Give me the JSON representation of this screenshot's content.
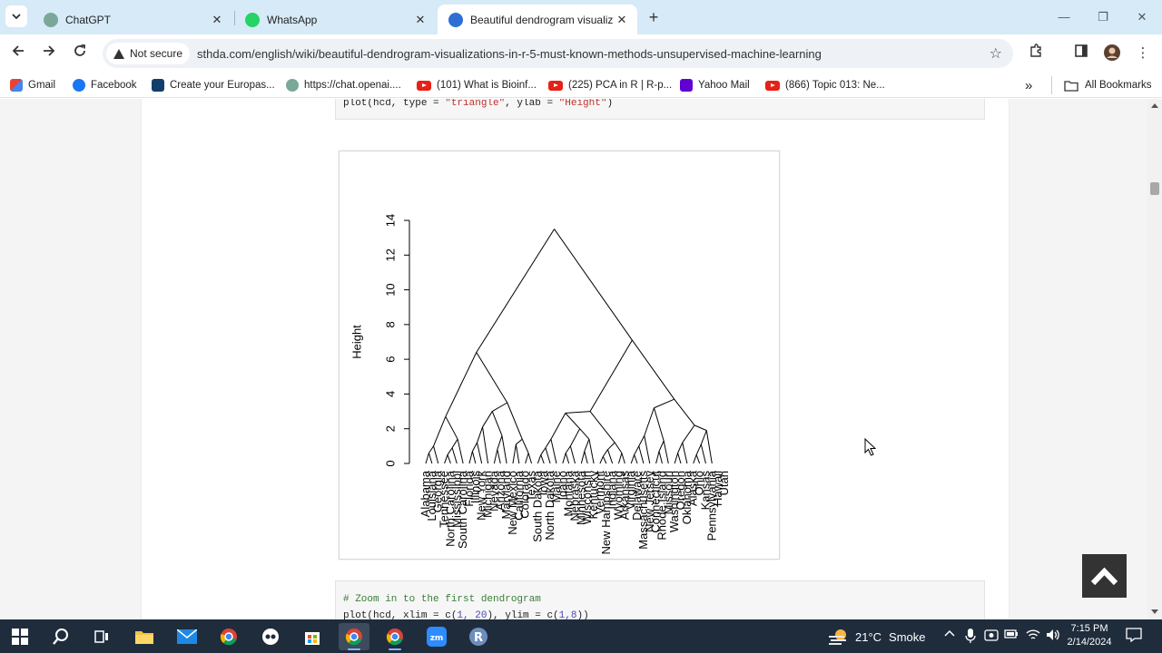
{
  "browser": {
    "tabs": [
      {
        "label": "ChatGPT",
        "color": "#7aa79a"
      },
      {
        "label": "WhatsApp",
        "color": "#25d366"
      },
      {
        "label": "Beautiful dendrogram visualiza",
        "color": "#2e6fd6"
      }
    ],
    "new_tab_icon": "+",
    "window_controls": {
      "minimize": "—",
      "restore": "❐",
      "close": "✕"
    },
    "security_chip": "Not secure",
    "url": "sthda.com/english/wiki/beautiful-dendrogram-visualizations-in-r-5-must-known-methods-unsupervised-machine-learning",
    "bookmarks": [
      {
        "label": "Gmail",
        "icon": "gmail-icon"
      },
      {
        "label": "Facebook",
        "icon": "facebook-icon"
      },
      {
        "label": "Create your Europas...",
        "icon": "europass-icon"
      },
      {
        "label": "https://chat.openai....",
        "icon": "openai-icon"
      },
      {
        "label": "(101) What is Bioinf...",
        "icon": "youtube-icon"
      },
      {
        "label": "(225) PCA in R | R-p...",
        "icon": "youtube-icon"
      },
      {
        "label": "Yahoo Mail",
        "icon": "yahoo-icon"
      },
      {
        "label": "(866) Topic 013: Ne...",
        "icon": "youtube-icon"
      }
    ],
    "bookmarks_overflow": "»",
    "all_bookmarks": "All Bookmarks"
  },
  "page": {
    "code_top": {
      "fn": "plot(hcd, type = ",
      "type_value": "\"triangle\"",
      "mid": ", ylab = ",
      "ylab_value": "\"Height\"",
      "end": ")"
    },
    "code_bottom": {
      "comment": "# Zoom in to the first dendrogram",
      "fn": "plot(hcd, xlim = c(",
      "xlim": "1, 20",
      "mid": "), ylim = c(",
      "ylim": "1,8",
      "end": "))"
    }
  },
  "chart_data": {
    "type": "dendrogram",
    "style": "triangle",
    "title": "",
    "xlabel": "",
    "ylabel": "Height",
    "ylim": [
      0,
      14
    ],
    "yticks": [
      0,
      2,
      4,
      6,
      8,
      10,
      12,
      14
    ],
    "leaves": [
      "Alabama",
      "Louisiana",
      "Georgia",
      "Tennessee",
      "North Carolina",
      "Mississippi",
      "South Carolina",
      "Florida",
      "Illinois",
      "New York",
      "Michigan",
      "Nevada",
      "Arizona",
      "Maryland",
      "New Mexico",
      "California",
      "Colorado",
      "Texas",
      "South Dakota",
      "Iowa",
      "North Dakota",
      "Maine",
      "Idaho",
      "Montana",
      "Nebraska",
      "Minnesota",
      "Wisconsin",
      "Kentucky",
      "Vermont",
      "New Hampshire",
      "Indiana",
      "Wyoming",
      "Arkansas",
      "Virginia",
      "Delaware",
      "Massachusetts",
      "New Jersey",
      "Connecticut",
      "Rhode Island",
      "Missouri",
      "Washington",
      "Oregon",
      "Oklahoma",
      "Alaska",
      "Ohio",
      "Kansas",
      "Pennsylvania",
      "Hawaii",
      "Utah"
    ],
    "top_merge_height": 13.5,
    "cluster_heights": [
      6.4,
      7.1,
      3.5,
      3.7
    ]
  },
  "taskbar": {
    "weather_temp": "21°C",
    "weather_label": "Smoke",
    "time": "7:15 PM",
    "date": "2/14/2024",
    "apps": [
      "windows-start-icon",
      "search-icon",
      "task-view-icon",
      "file-explorer-icon",
      "mail-icon",
      "chrome-icon",
      "app-icon",
      "store-icon",
      "chrome-active-icon",
      "chrome-alt-icon",
      "zoom-icon",
      "r-icon"
    ]
  }
}
